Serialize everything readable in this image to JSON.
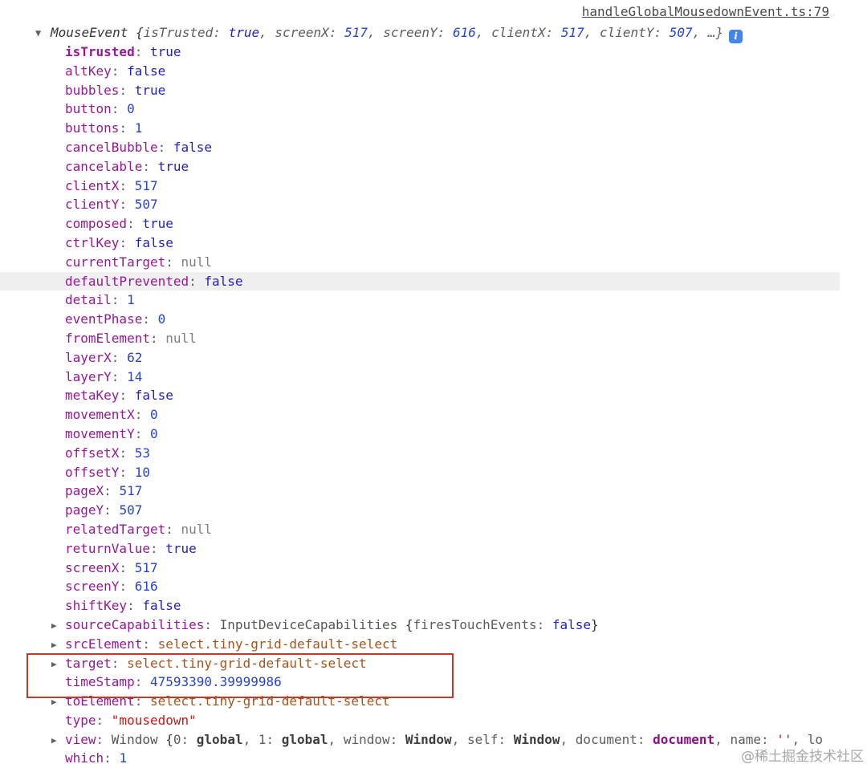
{
  "source_link": "handleGlobalMousedownEvent.ts:79",
  "watermark": "@稀土掘金技术社区",
  "icons": {
    "expanded_triangle": "▼",
    "collapsed_triangle": "▶",
    "info_icon_glyph": "i"
  },
  "colors": {
    "property_name": "#941994",
    "boolean_value": "#2222bd",
    "number_value": "#2745c9",
    "null_value": "#7f7f7f",
    "string_value": "#c41a16",
    "node_preview": "#a5541d",
    "annotation_box_border": "#c23b2a",
    "highlight_row_bg": "#f0f0f0",
    "info_icon_bg": "#4683ea"
  },
  "object_preview": {
    "expanded": true,
    "segments": [
      {
        "t": "p",
        "s": "MouseEvent "
      },
      {
        "t": "p",
        "s": "{"
      },
      {
        "t": "k",
        "s": "isTrusted"
      },
      {
        "t": "c",
        "s": ": "
      },
      {
        "t": "b",
        "s": "true"
      },
      {
        "t": "c",
        "s": ", "
      },
      {
        "t": "k",
        "s": "screenX"
      },
      {
        "t": "c",
        "s": ": "
      },
      {
        "t": "num",
        "s": "517"
      },
      {
        "t": "c",
        "s": ", "
      },
      {
        "t": "k",
        "s": "screenY"
      },
      {
        "t": "c",
        "s": ": "
      },
      {
        "t": "num",
        "s": "616"
      },
      {
        "t": "c",
        "s": ", "
      },
      {
        "t": "k",
        "s": "clientX"
      },
      {
        "t": "c",
        "s": ": "
      },
      {
        "t": "num",
        "s": "517"
      },
      {
        "t": "c",
        "s": ", "
      },
      {
        "t": "k",
        "s": "clientY"
      },
      {
        "t": "c",
        "s": ": "
      },
      {
        "t": "num",
        "s": "507"
      },
      {
        "t": "c",
        "s": ", …}"
      }
    ]
  },
  "properties": [
    {
      "name": "isTrusted",
      "expandable": false,
      "highlight": false,
      "segments": [
        {
          "t": "nb",
          "s": "isTrusted"
        },
        {
          "t": "c",
          "s": ": "
        },
        {
          "t": "b",
          "s": "true"
        }
      ]
    },
    {
      "name": "altKey",
      "expandable": false,
      "highlight": false,
      "segments": [
        {
          "t": "n",
          "s": "altKey"
        },
        {
          "t": "c",
          "s": ": "
        },
        {
          "t": "b",
          "s": "false"
        }
      ]
    },
    {
      "name": "bubbles",
      "expandable": false,
      "highlight": false,
      "segments": [
        {
          "t": "n",
          "s": "bubbles"
        },
        {
          "t": "c",
          "s": ": "
        },
        {
          "t": "b",
          "s": "true"
        }
      ]
    },
    {
      "name": "button",
      "expandable": false,
      "highlight": false,
      "segments": [
        {
          "t": "n",
          "s": "button"
        },
        {
          "t": "c",
          "s": ": "
        },
        {
          "t": "num",
          "s": "0"
        }
      ]
    },
    {
      "name": "buttons",
      "expandable": false,
      "highlight": false,
      "segments": [
        {
          "t": "n",
          "s": "buttons"
        },
        {
          "t": "c",
          "s": ": "
        },
        {
          "t": "num",
          "s": "1"
        }
      ]
    },
    {
      "name": "cancelBubble",
      "expandable": false,
      "highlight": false,
      "segments": [
        {
          "t": "n",
          "s": "cancelBubble"
        },
        {
          "t": "c",
          "s": ": "
        },
        {
          "t": "b",
          "s": "false"
        }
      ]
    },
    {
      "name": "cancelable",
      "expandable": false,
      "highlight": false,
      "segments": [
        {
          "t": "n",
          "s": "cancelable"
        },
        {
          "t": "c",
          "s": ": "
        },
        {
          "t": "b",
          "s": "true"
        }
      ]
    },
    {
      "name": "clientX",
      "expandable": false,
      "highlight": false,
      "segments": [
        {
          "t": "n",
          "s": "clientX"
        },
        {
          "t": "c",
          "s": ": "
        },
        {
          "t": "num",
          "s": "517"
        }
      ]
    },
    {
      "name": "clientY",
      "expandable": false,
      "highlight": false,
      "segments": [
        {
          "t": "n",
          "s": "clientY"
        },
        {
          "t": "c",
          "s": ": "
        },
        {
          "t": "num",
          "s": "507"
        }
      ]
    },
    {
      "name": "composed",
      "expandable": false,
      "highlight": false,
      "segments": [
        {
          "t": "n",
          "s": "composed"
        },
        {
          "t": "c",
          "s": ": "
        },
        {
          "t": "b",
          "s": "true"
        }
      ]
    },
    {
      "name": "ctrlKey",
      "expandable": false,
      "highlight": false,
      "segments": [
        {
          "t": "n",
          "s": "ctrlKey"
        },
        {
          "t": "c",
          "s": ": "
        },
        {
          "t": "b",
          "s": "false"
        }
      ]
    },
    {
      "name": "currentTarget",
      "expandable": false,
      "highlight": false,
      "segments": [
        {
          "t": "n",
          "s": "currentTarget"
        },
        {
          "t": "c",
          "s": ": "
        },
        {
          "t": "nul",
          "s": "null"
        }
      ]
    },
    {
      "name": "defaultPrevented",
      "expandable": false,
      "highlight": true,
      "segments": [
        {
          "t": "n",
          "s": "defaultPrevented"
        },
        {
          "t": "c",
          "s": ": "
        },
        {
          "t": "b",
          "s": "false"
        }
      ]
    },
    {
      "name": "detail",
      "expandable": false,
      "highlight": false,
      "segments": [
        {
          "t": "n",
          "s": "detail"
        },
        {
          "t": "c",
          "s": ": "
        },
        {
          "t": "num",
          "s": "1"
        }
      ]
    },
    {
      "name": "eventPhase",
      "expandable": false,
      "highlight": false,
      "segments": [
        {
          "t": "n",
          "s": "eventPhase"
        },
        {
          "t": "c",
          "s": ": "
        },
        {
          "t": "num",
          "s": "0"
        }
      ]
    },
    {
      "name": "fromElement",
      "expandable": false,
      "highlight": false,
      "segments": [
        {
          "t": "n",
          "s": "fromElement"
        },
        {
          "t": "c",
          "s": ": "
        },
        {
          "t": "nul",
          "s": "null"
        }
      ]
    },
    {
      "name": "layerX",
      "expandable": false,
      "highlight": false,
      "segments": [
        {
          "t": "n",
          "s": "layerX"
        },
        {
          "t": "c",
          "s": ": "
        },
        {
          "t": "num",
          "s": "62"
        }
      ]
    },
    {
      "name": "layerY",
      "expandable": false,
      "highlight": false,
      "segments": [
        {
          "t": "n",
          "s": "layerY"
        },
        {
          "t": "c",
          "s": ": "
        },
        {
          "t": "num",
          "s": "14"
        }
      ]
    },
    {
      "name": "metaKey",
      "expandable": false,
      "highlight": false,
      "segments": [
        {
          "t": "n",
          "s": "metaKey"
        },
        {
          "t": "c",
          "s": ": "
        },
        {
          "t": "b",
          "s": "false"
        }
      ]
    },
    {
      "name": "movementX",
      "expandable": false,
      "highlight": false,
      "segments": [
        {
          "t": "n",
          "s": "movementX"
        },
        {
          "t": "c",
          "s": ": "
        },
        {
          "t": "num",
          "s": "0"
        }
      ]
    },
    {
      "name": "movementY",
      "expandable": false,
      "highlight": false,
      "segments": [
        {
          "t": "n",
          "s": "movementY"
        },
        {
          "t": "c",
          "s": ": "
        },
        {
          "t": "num",
          "s": "0"
        }
      ]
    },
    {
      "name": "offsetX",
      "expandable": false,
      "highlight": false,
      "segments": [
        {
          "t": "n",
          "s": "offsetX"
        },
        {
          "t": "c",
          "s": ": "
        },
        {
          "t": "num",
          "s": "53"
        }
      ]
    },
    {
      "name": "offsetY",
      "expandable": false,
      "highlight": false,
      "segments": [
        {
          "t": "n",
          "s": "offsetY"
        },
        {
          "t": "c",
          "s": ": "
        },
        {
          "t": "num",
          "s": "10"
        }
      ]
    },
    {
      "name": "pageX",
      "expandable": false,
      "highlight": false,
      "segments": [
        {
          "t": "n",
          "s": "pageX"
        },
        {
          "t": "c",
          "s": ": "
        },
        {
          "t": "num",
          "s": "517"
        }
      ]
    },
    {
      "name": "pageY",
      "expandable": false,
      "highlight": false,
      "segments": [
        {
          "t": "n",
          "s": "pageY"
        },
        {
          "t": "c",
          "s": ": "
        },
        {
          "t": "num",
          "s": "507"
        }
      ]
    },
    {
      "name": "relatedTarget",
      "expandable": false,
      "highlight": false,
      "segments": [
        {
          "t": "n",
          "s": "relatedTarget"
        },
        {
          "t": "c",
          "s": ": "
        },
        {
          "t": "nul",
          "s": "null"
        }
      ]
    },
    {
      "name": "returnValue",
      "expandable": false,
      "highlight": false,
      "segments": [
        {
          "t": "n",
          "s": "returnValue"
        },
        {
          "t": "c",
          "s": ": "
        },
        {
          "t": "b",
          "s": "true"
        }
      ]
    },
    {
      "name": "screenX",
      "expandable": false,
      "highlight": false,
      "segments": [
        {
          "t": "n",
          "s": "screenX"
        },
        {
          "t": "c",
          "s": ": "
        },
        {
          "t": "num",
          "s": "517"
        }
      ]
    },
    {
      "name": "screenY",
      "expandable": false,
      "highlight": false,
      "segments": [
        {
          "t": "n",
          "s": "screenY"
        },
        {
          "t": "c",
          "s": ": "
        },
        {
          "t": "num",
          "s": "616"
        }
      ]
    },
    {
      "name": "shiftKey",
      "expandable": false,
      "highlight": false,
      "segments": [
        {
          "t": "n",
          "s": "shiftKey"
        },
        {
          "t": "c",
          "s": ": "
        },
        {
          "t": "b",
          "s": "false"
        }
      ]
    },
    {
      "name": "sourceCapabilities",
      "expandable": true,
      "highlight": false,
      "segments": [
        {
          "t": "n",
          "s": "sourceCapabilities"
        },
        {
          "t": "c",
          "s": ": "
        },
        {
          "t": "o",
          "s": "InputDeviceCapabilities "
        },
        {
          "t": "p",
          "s": "{"
        },
        {
          "t": "k",
          "s": "firesTouchEvents"
        },
        {
          "t": "c",
          "s": ": "
        },
        {
          "t": "b",
          "s": "false"
        },
        {
          "t": "p",
          "s": "}"
        }
      ]
    },
    {
      "name": "srcElement",
      "expandable": true,
      "highlight": false,
      "segments": [
        {
          "t": "n",
          "s": "srcElement"
        },
        {
          "t": "c",
          "s": ": "
        },
        {
          "t": "nd",
          "s": "select.tiny-grid-default-select"
        }
      ]
    },
    {
      "name": "target",
      "expandable": true,
      "highlight": false,
      "segments": [
        {
          "t": "n",
          "s": "target"
        },
        {
          "t": "c",
          "s": ": "
        },
        {
          "t": "nd",
          "s": "select.tiny-grid-default-select"
        }
      ]
    },
    {
      "name": "timeStamp",
      "expandable": false,
      "highlight": false,
      "segments": [
        {
          "t": "n",
          "s": "timeStamp"
        },
        {
          "t": "c",
          "s": ": "
        },
        {
          "t": "num",
          "s": "47593390.39999986"
        }
      ]
    },
    {
      "name": "toElement",
      "expandable": true,
      "highlight": false,
      "segments": [
        {
          "t": "n",
          "s": "toElement"
        },
        {
          "t": "c",
          "s": ": "
        },
        {
          "t": "nd",
          "s": "select.tiny-grid-default-select"
        }
      ]
    },
    {
      "name": "type",
      "expandable": false,
      "highlight": false,
      "segments": [
        {
          "t": "n",
          "s": "type"
        },
        {
          "t": "c",
          "s": ": "
        },
        {
          "t": "s",
          "s": "\"mousedown\""
        }
      ]
    },
    {
      "name": "view",
      "expandable": true,
      "highlight": false,
      "segments": [
        {
          "t": "n",
          "s": "view"
        },
        {
          "t": "c",
          "s": ": "
        },
        {
          "t": "o",
          "s": "Window "
        },
        {
          "t": "p",
          "s": "{"
        },
        {
          "t": "k",
          "s": "0"
        },
        {
          "t": "c",
          "s": ": "
        },
        {
          "t": "ob",
          "s": "global"
        },
        {
          "t": "c",
          "s": ", "
        },
        {
          "t": "k",
          "s": "1"
        },
        {
          "t": "c",
          "s": ": "
        },
        {
          "t": "ob",
          "s": "global"
        },
        {
          "t": "c",
          "s": ", "
        },
        {
          "t": "k",
          "s": "window"
        },
        {
          "t": "c",
          "s": ": "
        },
        {
          "t": "ob",
          "s": "Window"
        },
        {
          "t": "c",
          "s": ", "
        },
        {
          "t": "k",
          "s": "self"
        },
        {
          "t": "c",
          "s": ": "
        },
        {
          "t": "ob",
          "s": "Window"
        },
        {
          "t": "c",
          "s": ", "
        },
        {
          "t": "k",
          "s": "document"
        },
        {
          "t": "c",
          "s": ": "
        },
        {
          "t": "dn",
          "s": "document"
        },
        {
          "t": "c",
          "s": ", "
        },
        {
          "t": "k",
          "s": "name"
        },
        {
          "t": "c",
          "s": ": "
        },
        {
          "t": "s",
          "s": "''"
        },
        {
          "t": "c",
          "s": ", "
        },
        {
          "t": "k",
          "s": "lo"
        }
      ]
    },
    {
      "name": "which",
      "expandable": false,
      "highlight": false,
      "segments": [
        {
          "t": "n",
          "s": "which"
        },
        {
          "t": "c",
          "s": ": "
        },
        {
          "t": "num",
          "s": "1"
        }
      ]
    }
  ]
}
